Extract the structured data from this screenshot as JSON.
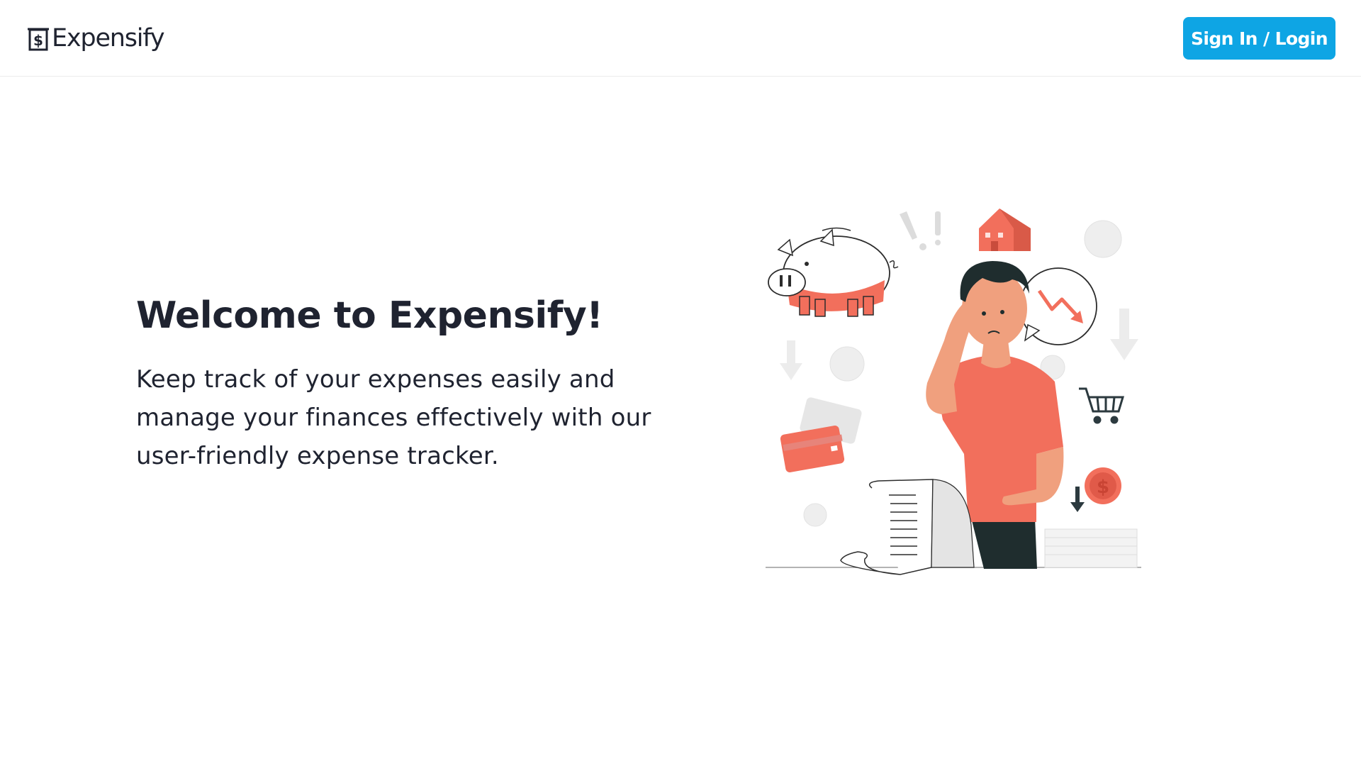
{
  "brand": {
    "name": "Expensify",
    "icon": "dollar-receipt-icon"
  },
  "nav": {
    "signin_label": "Sign In / Login"
  },
  "hero": {
    "title": "Welcome to Expensify!",
    "text": "Keep track of your expenses easily and manage your finances effectively with our user-friendly expense tracker."
  },
  "colors": {
    "accent": "#0ea5e4",
    "illustration_coral": "#f26f5c",
    "text": "#1f2330"
  }
}
